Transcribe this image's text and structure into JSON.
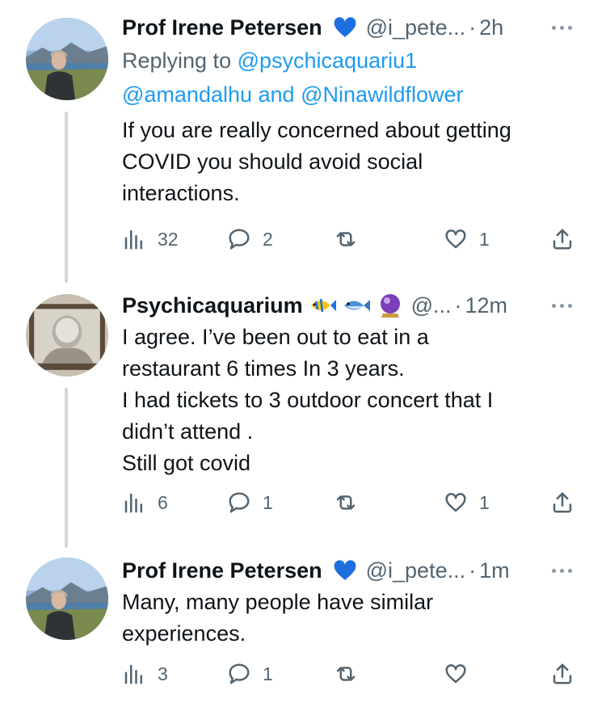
{
  "tweets": [
    {
      "name": "Prof Irene Petersen",
      "handle": "@i_pete...",
      "time": "2h",
      "replying_prefix": "Replying to",
      "replying_line1": "@psychicaquariu1",
      "replying_line2": "@amandalhu and @Ninawildflower",
      "text": "If you are really concerned about getting\nCOVID you should avoid social\ninteractions.",
      "views": "32",
      "replies": "2",
      "retweets": "",
      "likes": "1"
    },
    {
      "name": "Psychicaquarium",
      "handle": "@...",
      "time": "12m",
      "text": "I agree. I’ve been out to eat in a\nrestaurant 6 times In 3 years.\nI had tickets to 3 outdoor concert that I\ndidn’t attend .\nStill got covid",
      "views": "6",
      "replies": "1",
      "retweets": "",
      "likes": "1"
    },
    {
      "name": "Prof Irene Petersen",
      "handle": "@i_pete...",
      "time": "1m",
      "text": "Many, many people have similar\nexperiences.",
      "views": "3",
      "replies": "1",
      "retweets": "",
      "likes": ""
    }
  ],
  "separator": "·",
  "colors": {
    "heart_badge": "#1d6fe0",
    "link": "#1d9bf0",
    "muted": "#536471",
    "thread_line": "#cfd9de"
  },
  "icons": [
    "views-icon",
    "reply-icon",
    "retweet-icon",
    "like-icon",
    "share-icon",
    "more-icon",
    "blue-heart-icon",
    "fish-icon",
    "tropical-fish-icon",
    "crystal-ball-icon"
  ]
}
